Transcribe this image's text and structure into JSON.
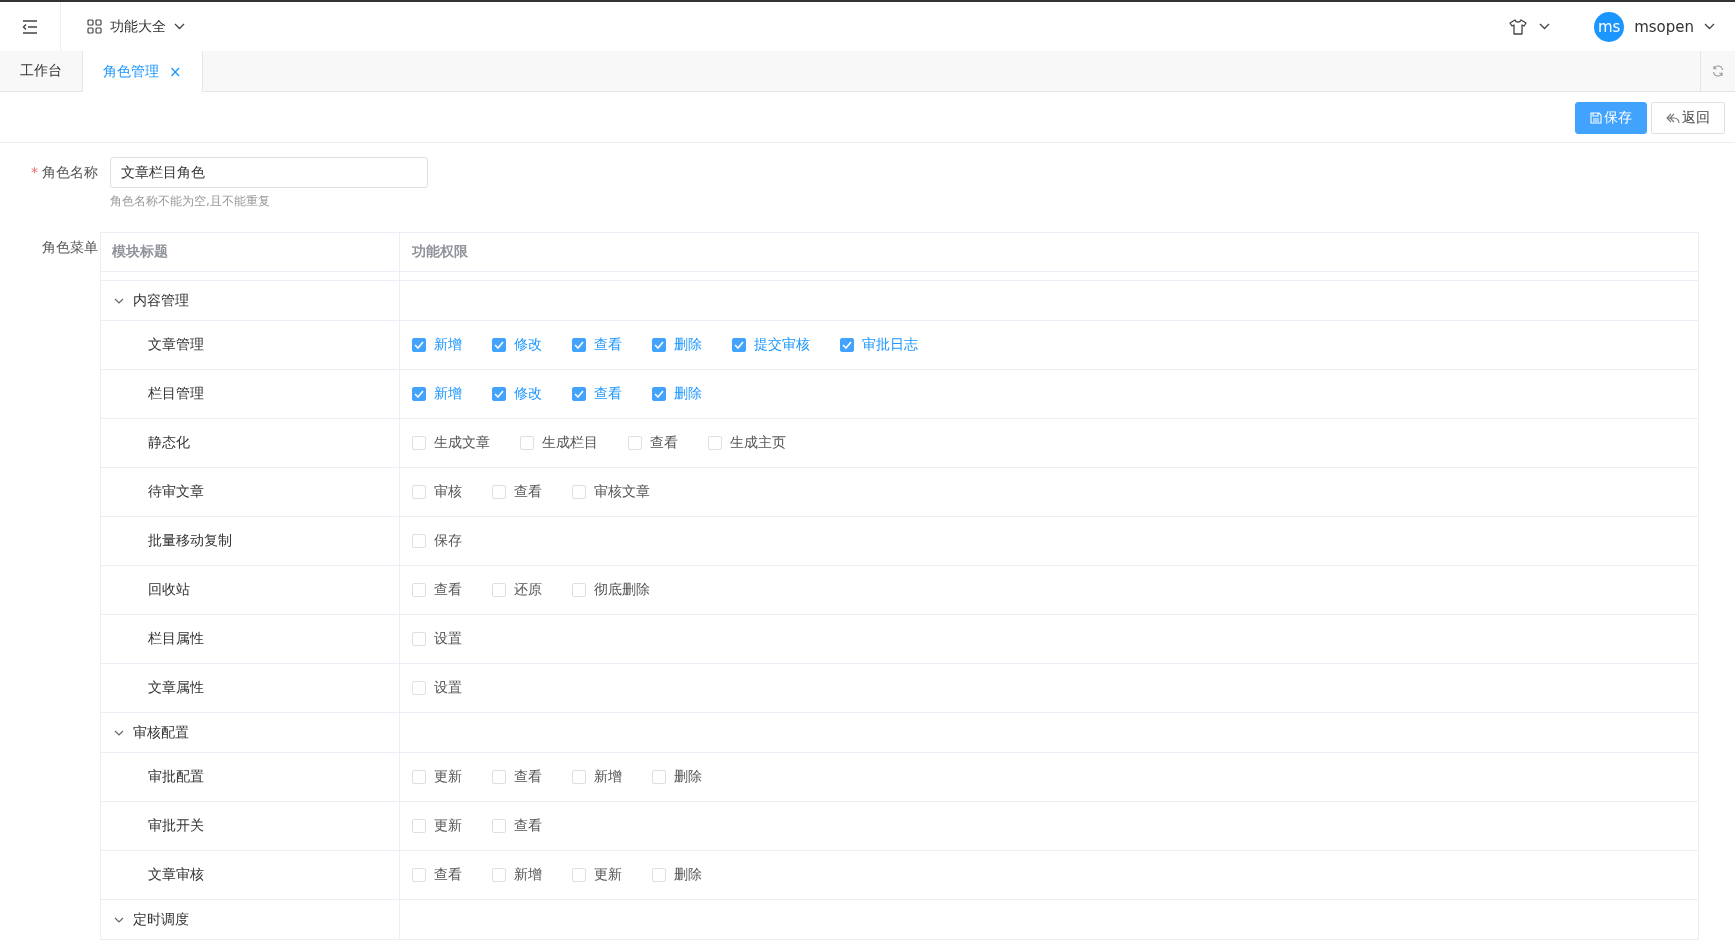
{
  "header": {
    "app_menu": "功能大全",
    "user": {
      "avatar": "ms",
      "name": "msopen"
    }
  },
  "tabs": [
    {
      "label": "工作台",
      "selected": false
    },
    {
      "label": "角色管理",
      "selected": true,
      "close": "×"
    }
  ],
  "toolbar": {
    "buttons": [
      {
        "label": "保存",
        "kind": "primary"
      },
      {
        "label": "返回",
        "kind": "back"
      }
    ]
  },
  "form": {
    "name_field": {
      "label": "角色名称",
      "required_mark": "*",
      "value": "文章栏目角色",
      "hint": "角色名称不能为空,且不能重复"
    },
    "menu_label": "角色菜单"
  },
  "table": {
    "columns": [
      "模块标题",
      "功能权限"
    ],
    "groups": [
      {
        "title": "内容管理",
        "expanded": true,
        "children": [
          {
            "title": "文章管理",
            "permissions": [
              {
                "label": "新增",
                "checked": true
              },
              {
                "label": "修改",
                "checked": true
              },
              {
                "label": "查看",
                "checked": true
              },
              {
                "label": "删除",
                "checked": true
              },
              {
                "label": "提交审核",
                "checked": true
              },
              {
                "label": "审批日志",
                "checked": true
              }
            ]
          },
          {
            "title": "栏目管理",
            "permissions": [
              {
                "label": "新增",
                "checked": true
              },
              {
                "label": "修改",
                "checked": true
              },
              {
                "label": "查看",
                "checked": true
              },
              {
                "label": "删除",
                "checked": true
              }
            ]
          },
          {
            "title": "静态化",
            "permissions": [
              {
                "label": "生成文章",
                "checked": false
              },
              {
                "label": "生成栏目",
                "checked": false
              },
              {
                "label": "查看",
                "checked": false
              },
              {
                "label": "生成主页",
                "checked": false
              }
            ]
          },
          {
            "title": "待审文章",
            "permissions": [
              {
                "label": "审核",
                "checked": false
              },
              {
                "label": "查看",
                "checked": false
              },
              {
                "label": "审核文章",
                "checked": false
              }
            ]
          },
          {
            "title": "批量移动复制",
            "permissions": [
              {
                "label": "保存",
                "checked": false
              }
            ]
          },
          {
            "title": "回收站",
            "permissions": [
              {
                "label": "查看",
                "checked": false
              },
              {
                "label": "还原",
                "checked": false
              },
              {
                "label": "彻底删除",
                "checked": false
              }
            ]
          },
          {
            "title": "栏目属性",
            "permissions": [
              {
                "label": "设置",
                "checked": false
              }
            ]
          },
          {
            "title": "文章属性",
            "permissions": [
              {
                "label": "设置",
                "checked": false
              }
            ]
          }
        ]
      },
      {
        "title": "审核配置",
        "expanded": true,
        "children": [
          {
            "title": "审批配置",
            "permissions": [
              {
                "label": "更新",
                "checked": false
              },
              {
                "label": "查看",
                "checked": false
              },
              {
                "label": "新增",
                "checked": false
              },
              {
                "label": "删除",
                "checked": false
              }
            ]
          },
          {
            "title": "审批开关",
            "permissions": [
              {
                "label": "更新",
                "checked": false
              },
              {
                "label": "查看",
                "checked": false
              }
            ]
          },
          {
            "title": "文章审核",
            "permissions": [
              {
                "label": "查看",
                "checked": false
              },
              {
                "label": "新增",
                "checked": false
              },
              {
                "label": "更新",
                "checked": false
              },
              {
                "label": "删除",
                "checked": false
              }
            ]
          }
        ]
      },
      {
        "title": "定时调度",
        "expanded": true
      }
    ]
  }
}
